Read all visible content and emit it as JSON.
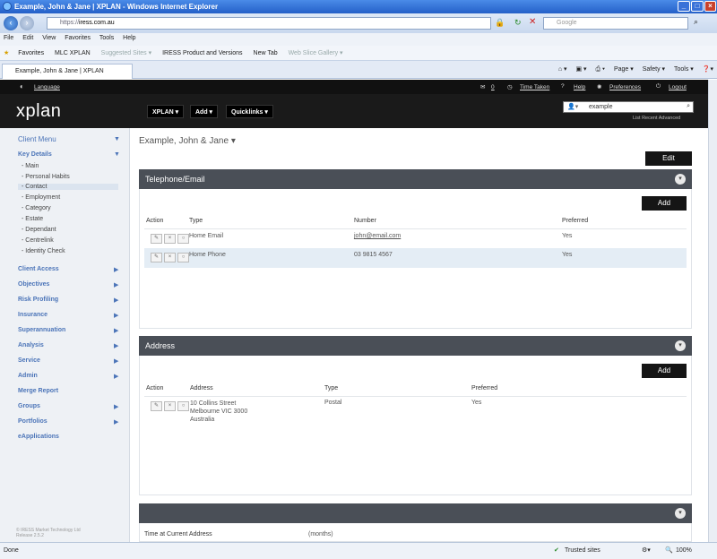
{
  "browser": {
    "title": "Example, John & Jane  |  XPLAN - Windows Internet Explorer",
    "url_prefix": "https://",
    "url_domain": "iress.com.au",
    "search_placeholder": "Google",
    "menu": [
      "File",
      "Edit",
      "View",
      "Favorites",
      "Tools",
      "Help"
    ],
    "favorites": {
      "label": "Favorites",
      "items": [
        "MLC XPLAN",
        "Suggested Sites ▾",
        "IRESS Product and Versions",
        "New Tab",
        "Web Slice Gallery ▾"
      ]
    },
    "tab_title": "Example, John & Jane  |  XPLAN",
    "command_bar": [
      "Page ▾",
      "Safety ▾",
      "Tools ▾"
    ],
    "status_left": "Done",
    "trusted": "Trusted sites",
    "zoom": "100%"
  },
  "topstrip": {
    "language": "Language",
    "count": "0",
    "time_taken": "Time Taken",
    "help": "Help",
    "preferences": "Preferences",
    "logout": "Logout"
  },
  "header": {
    "logo": "xplan",
    "buttons": [
      "XPLAN ▾",
      "Add ▾",
      "Quicklinks ▾"
    ],
    "search_value": "example",
    "links": "List  Recent  Advanced"
  },
  "sidebar": {
    "client_menu": "Client Menu",
    "key_details": "Key Details",
    "key_details_items": [
      "- Main",
      "- Personal Habits",
      "- Contact",
      "- Employment",
      "- Category",
      "- Estate",
      "- Dependant",
      "- Centrelink",
      "- Identity Check"
    ],
    "sections": [
      "Client Access",
      "Objectives",
      "Risk Profiling",
      "Insurance",
      "Superannuation",
      "Analysis",
      "Service",
      "Admin",
      "Merge Report",
      "Groups",
      "Portfolios",
      "eApplications"
    ],
    "copyright": "© IRESS Market Technology Ltd",
    "release": "Release 2.5.2"
  },
  "main": {
    "breadcrumb": "Example, John & Jane ▾",
    "edit": "Edit",
    "telephone": {
      "title": "Telephone/Email",
      "add": "Add",
      "headers": [
        "Action",
        "Type",
        "Number",
        "Preferred"
      ],
      "rows": [
        {
          "type": "Home Email",
          "number": "john@email.com",
          "preferred": "Yes"
        },
        {
          "type": "Home Phone",
          "number": "03 9815 4567",
          "preferred": "Yes"
        }
      ]
    },
    "address": {
      "title": "Address",
      "add": "Add",
      "headers": [
        "Action",
        "Address",
        "Type",
        "Preferred"
      ],
      "rows": [
        {
          "line1": "10 Collins Street",
          "line2": "Melbourne VIC 3000",
          "line3": "Australia",
          "type": "Postal",
          "preferred": "Yes"
        }
      ]
    },
    "third": {
      "label": "Time at Current Address",
      "unit": "(months)"
    }
  }
}
